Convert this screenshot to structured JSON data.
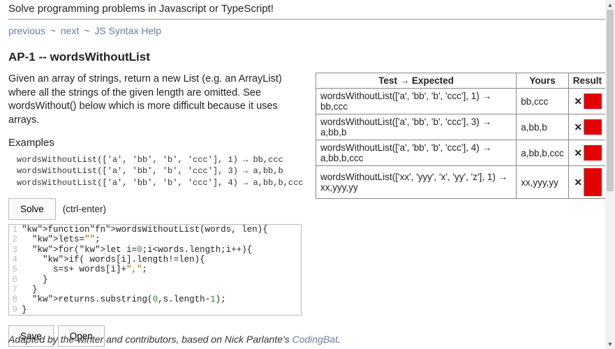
{
  "banner": "Solve programming problems in Javascript or TypeScript!",
  "nav": {
    "previous": "previous",
    "next": "next",
    "help": "JS Syntax Help",
    "sep": "~"
  },
  "title": "AP-1 -- wordsWithoutList",
  "description": "Given an array of strings, return a new List (e.g. an ArrayList) where all the strings of the given length are omitted. See wordsWithout() below which is more difficult because it uses arrays.",
  "examples_label": "Examples",
  "examples": "wordsWithoutList(['a', 'bb', 'b', 'ccc'], 1) → bb,ccc\nwordsWithoutList(['a', 'bb', 'b', 'ccc'], 3) → a,bb,b\nwordsWithoutList(['a', 'bb', 'b', 'ccc'], 4) → a,bb,b,ccc",
  "buttons": {
    "solve": "Solve",
    "hint": "(ctrl-enter)",
    "save": "Save",
    "open": "Open"
  },
  "code": {
    "lines": [
      "function wordsWithoutList(words, len){",
      "  let s=\"\";",
      "  for(let i=0;i<words.length;i++){",
      "    if( words[i].length!=len){",
      "      s=s+ words[i]+\",\";",
      "    }",
      "  }",
      "  return s.substring(0,s.length-1);",
      "}"
    ]
  },
  "table": {
    "headers": {
      "test": "Test → Expected",
      "yours": "Yours",
      "result": "Result"
    },
    "rows": [
      {
        "test": "wordsWithoutList(['a', 'bb', 'b', 'ccc'], 1) → bb,ccc",
        "yours": "bb,ccc",
        "pass": false
      },
      {
        "test": "wordsWithoutList(['a', 'bb', 'b', 'ccc'], 3) → a,bb,b",
        "yours": "a,bb,b",
        "pass": false
      },
      {
        "test": "wordsWithoutList(['a', 'bb', 'b', 'ccc'], 4) → a,bb,b,ccc",
        "yours": "a,bb,b,ccc",
        "pass": false
      },
      {
        "test": "wordsWithoutList(['xx', 'yyy', 'x', 'yy', 'z'], 1) → xx,yyy,yy",
        "yours": "xx,yyy,yy",
        "pass": false
      }
    ]
  },
  "footer": {
    "text_a": "Adapted by the-winter and contributors, based on Nick Parlante's ",
    "link": "CodingBat",
    "text_b": "."
  },
  "icons": {
    "fail": "✕"
  }
}
